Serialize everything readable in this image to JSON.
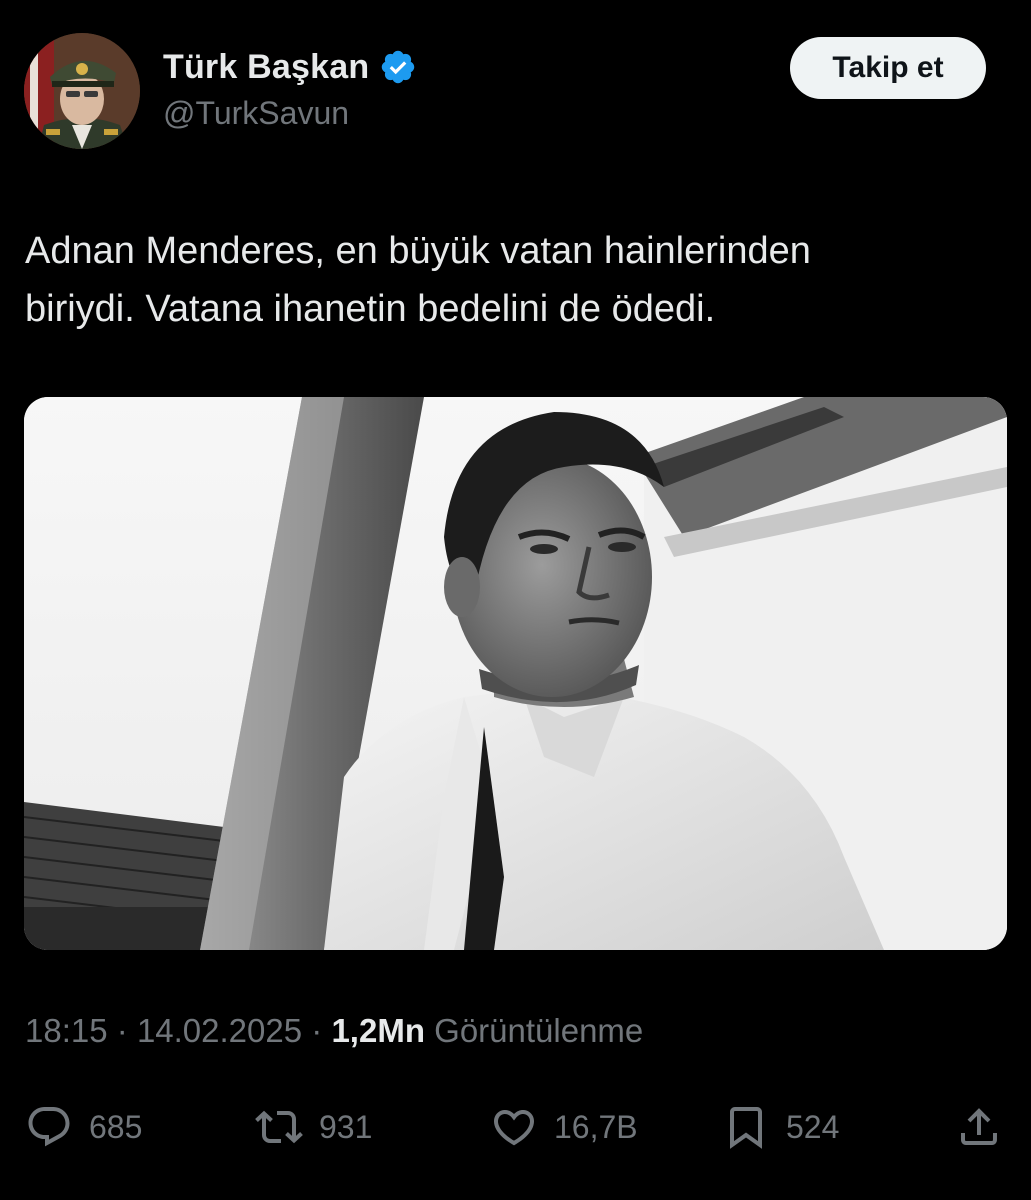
{
  "author": {
    "display_name": "Türk Başkan",
    "handle": "@TurkSavun",
    "verified_icon": "verified-badge-icon",
    "avatar_icon": "avatar-portrait"
  },
  "follow_label": "Takip et",
  "text": "Adnan Menderes, en büyük vatan hainlerinden\nbiriydi. Vatana ihanetin bedelini de ödedi.",
  "media": {
    "type": "photo",
    "description_icon": "black-and-white-portrait-photo"
  },
  "meta": {
    "time": "18:15",
    "separator": "·",
    "date": "14.02.2025",
    "views_count": "1,2Mn",
    "views_label": "Görüntülenme"
  },
  "actions": {
    "reply": {
      "icon": "reply-icon",
      "count": "685"
    },
    "retweet": {
      "icon": "retweet-icon",
      "count": "931"
    },
    "like": {
      "icon": "heart-icon",
      "count": "16,7B"
    },
    "bookmark": {
      "icon": "bookmark-icon",
      "count": "524"
    },
    "share": {
      "icon": "share-icon"
    }
  },
  "colors": {
    "background": "#000000",
    "text_primary": "#e7e9ea",
    "text_secondary": "#71767b",
    "verified_blue": "#1d9bf0",
    "follow_button_bg": "#eff3f4"
  }
}
